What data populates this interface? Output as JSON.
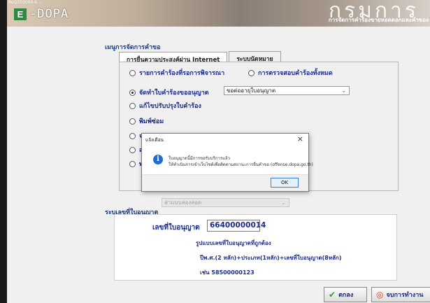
{
  "banner": {
    "tiny_text": "ReQ010004-6 ...",
    "logo_badge": "E",
    "logo_text": "-DOPA",
    "big_text": "กรมการ",
    "subtitle": "การจัดการคำร้องขายหอดดอกและคำของ"
  },
  "form": {
    "group_title": "เมนูการจัดการคำขอ",
    "tabs": [
      {
        "label": "การยื่นความประสงค์ผ่าน Internet"
      },
      {
        "label": "ระบบนัดหมาย"
      }
    ],
    "options": {
      "pending_list": "รายการคำร้องที่รอการพิจารณา",
      "check_all": "การตรวจสอบคำร้องทั้งหมด",
      "create_request": "จัดทำใบคำร้องขออนุญาต",
      "edit_request": "แก้ไขปรับปรุงใบคำร้อง",
      "print_again": "พิมพ์ซ่อม",
      "hidden_a": "จ",
      "hidden_b": "ส",
      "hidden_c": "พ"
    },
    "request_type_select": "ขอต่ออายุใบอนุญาต",
    "disabled_select": "ล่าแบบล่องลอด"
  },
  "license": {
    "section_title": "ระบุเลขที่ใบอนุญาต",
    "label": "เลขที่ใบอนุญาต",
    "value": "66400000014",
    "hint_format": "รูปแบบเลขที่ใบอนุญาตที่ถูกต้อง",
    "hint_pattern": "ปีพ.ศ.(2 หลัก)+ประเภท(1หลัก)+เลขที่ใบอนุญาต(8หลัก)",
    "hint_example": "เช่น 58500000123"
  },
  "buttons": {
    "ok": "ตกลง",
    "exit": "จบการทำงาน"
  },
  "dialog": {
    "title": "แจ้งเตือน",
    "close": "×",
    "icon_glyph": "i",
    "line1": "ใบอนุญาตนี้มีการขอรับบริการแล้ว",
    "line2": "ให้ทำเนินการเข้าเว็บไซต์เพื่อติดตามสถานะการยื่นคำขอ (offense.dopa.go.th)",
    "ok": "OK"
  }
}
